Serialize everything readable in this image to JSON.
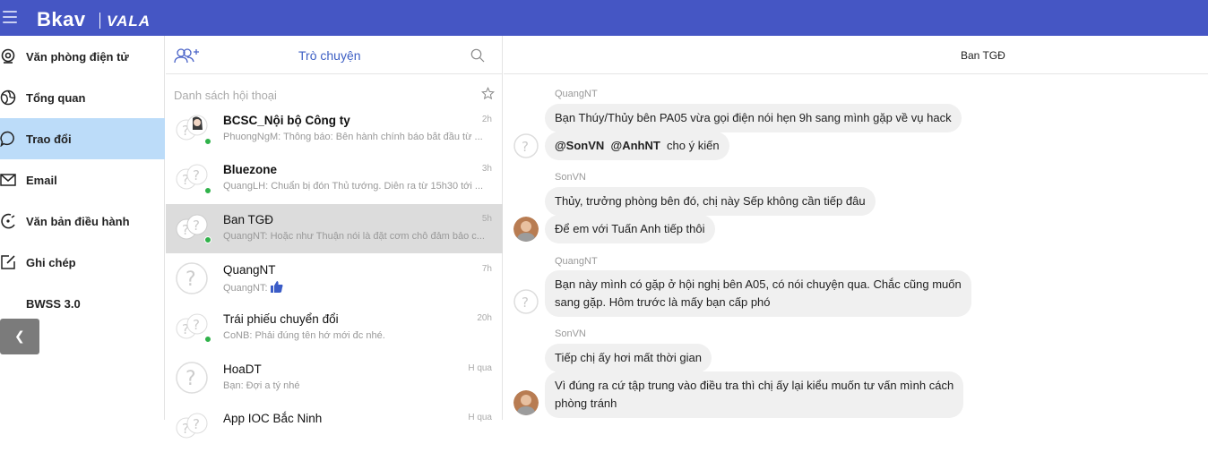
{
  "app": {
    "logo": "Bkav",
    "logo2": "VALA"
  },
  "nav": {
    "items": [
      {
        "label": "Văn phòng điện tử",
        "icon": "webcam-icon"
      },
      {
        "label": "Tổng quan",
        "icon": "globe-icon"
      },
      {
        "label": "Trao đổi",
        "icon": "chat-bubble-icon"
      },
      {
        "label": "Email",
        "icon": "mail-icon"
      },
      {
        "label": "Văn bản điều hành",
        "icon": "document-moon-icon"
      },
      {
        "label": "Ghi chép",
        "icon": "edit-note-icon"
      },
      {
        "label": "BWSS 3.0",
        "icon": "bwss-icon"
      }
    ],
    "active_index": 2
  },
  "convlist": {
    "title": "Trò chuyện",
    "caption": "Danh sách hội thoại",
    "items": [
      {
        "name": "BCSC_Nội bộ Công ty",
        "preview": "PhuongNgM: Thông báo: Bên hành chính báo bắt đầu từ ...",
        "time": "2h",
        "bold": true,
        "online": true
      },
      {
        "name": "Bluezone",
        "preview": "QuangLH: Chuẩn bị đón Thủ tướng. Diễn ra từ 15h30 tới ...",
        "time": "3h",
        "bold": true,
        "online": true
      },
      {
        "name": "Ban TGĐ",
        "preview": "QuangNT: Hoặc như Thuận nói là đặt cơm chỗ đảm bảo c...",
        "time": "5h",
        "bold": false,
        "online": true
      },
      {
        "name": "QuangNT",
        "preview": "QuangNT:",
        "time": "7h",
        "bold": false,
        "online": false
      },
      {
        "name": "Trái phiếu chuyển đổi",
        "preview": "CoNB: Phải đúng tên hớ mới đc nhé.",
        "time": "20h",
        "bold": false,
        "online": true
      },
      {
        "name": "HoaDT",
        "preview": "Bạn: Đợi a tý nhé",
        "time": "H qua",
        "bold": false,
        "online": false
      },
      {
        "name": "App IOC Bắc Ninh",
        "preview": "",
        "time": "H qua",
        "bold": false,
        "online": false
      }
    ]
  },
  "chat": {
    "title": "Ban TGĐ",
    "groups": [
      {
        "sender": "QuangNT",
        "messages": [
          "Bạn Thúy/Thủy bên PA05 vừa gọi điện nói hẹn 9h sang mình gặp về vụ hack"
        ],
        "mention_msg": {
          "m1": "@SonVN",
          "m2": "@AnhNT",
          "rest": "cho ý kiến"
        }
      },
      {
        "sender": "SonVN",
        "messages": [
          "Thủy, trưởng phòng bên đó, chị này Sếp không cần tiếp đâu",
          "Để em với Tuấn Anh tiếp thôi"
        ]
      },
      {
        "sender": "QuangNT",
        "messages": [
          "Bạn này mình có gặp ở hội nghị bên A05, có nói chuyện qua. Chắc cũng muốn",
          "sang gặp. Hôm trước là mấy bạn cấp phó"
        ]
      },
      {
        "sender": "SonVN",
        "messages": [
          "Tiếp chị ấy hơi mất thời gian",
          "Vì đúng ra cứ tập trung vào điều tra thì chị ấy lại kiểu muốn tư vấn mình cách",
          "phòng tránh"
        ]
      }
    ]
  },
  "colors": {
    "topbar": "#4556c4",
    "active_nav": "#bcdcf9",
    "accent": "#3d5fc4",
    "online": "#30b24a"
  }
}
